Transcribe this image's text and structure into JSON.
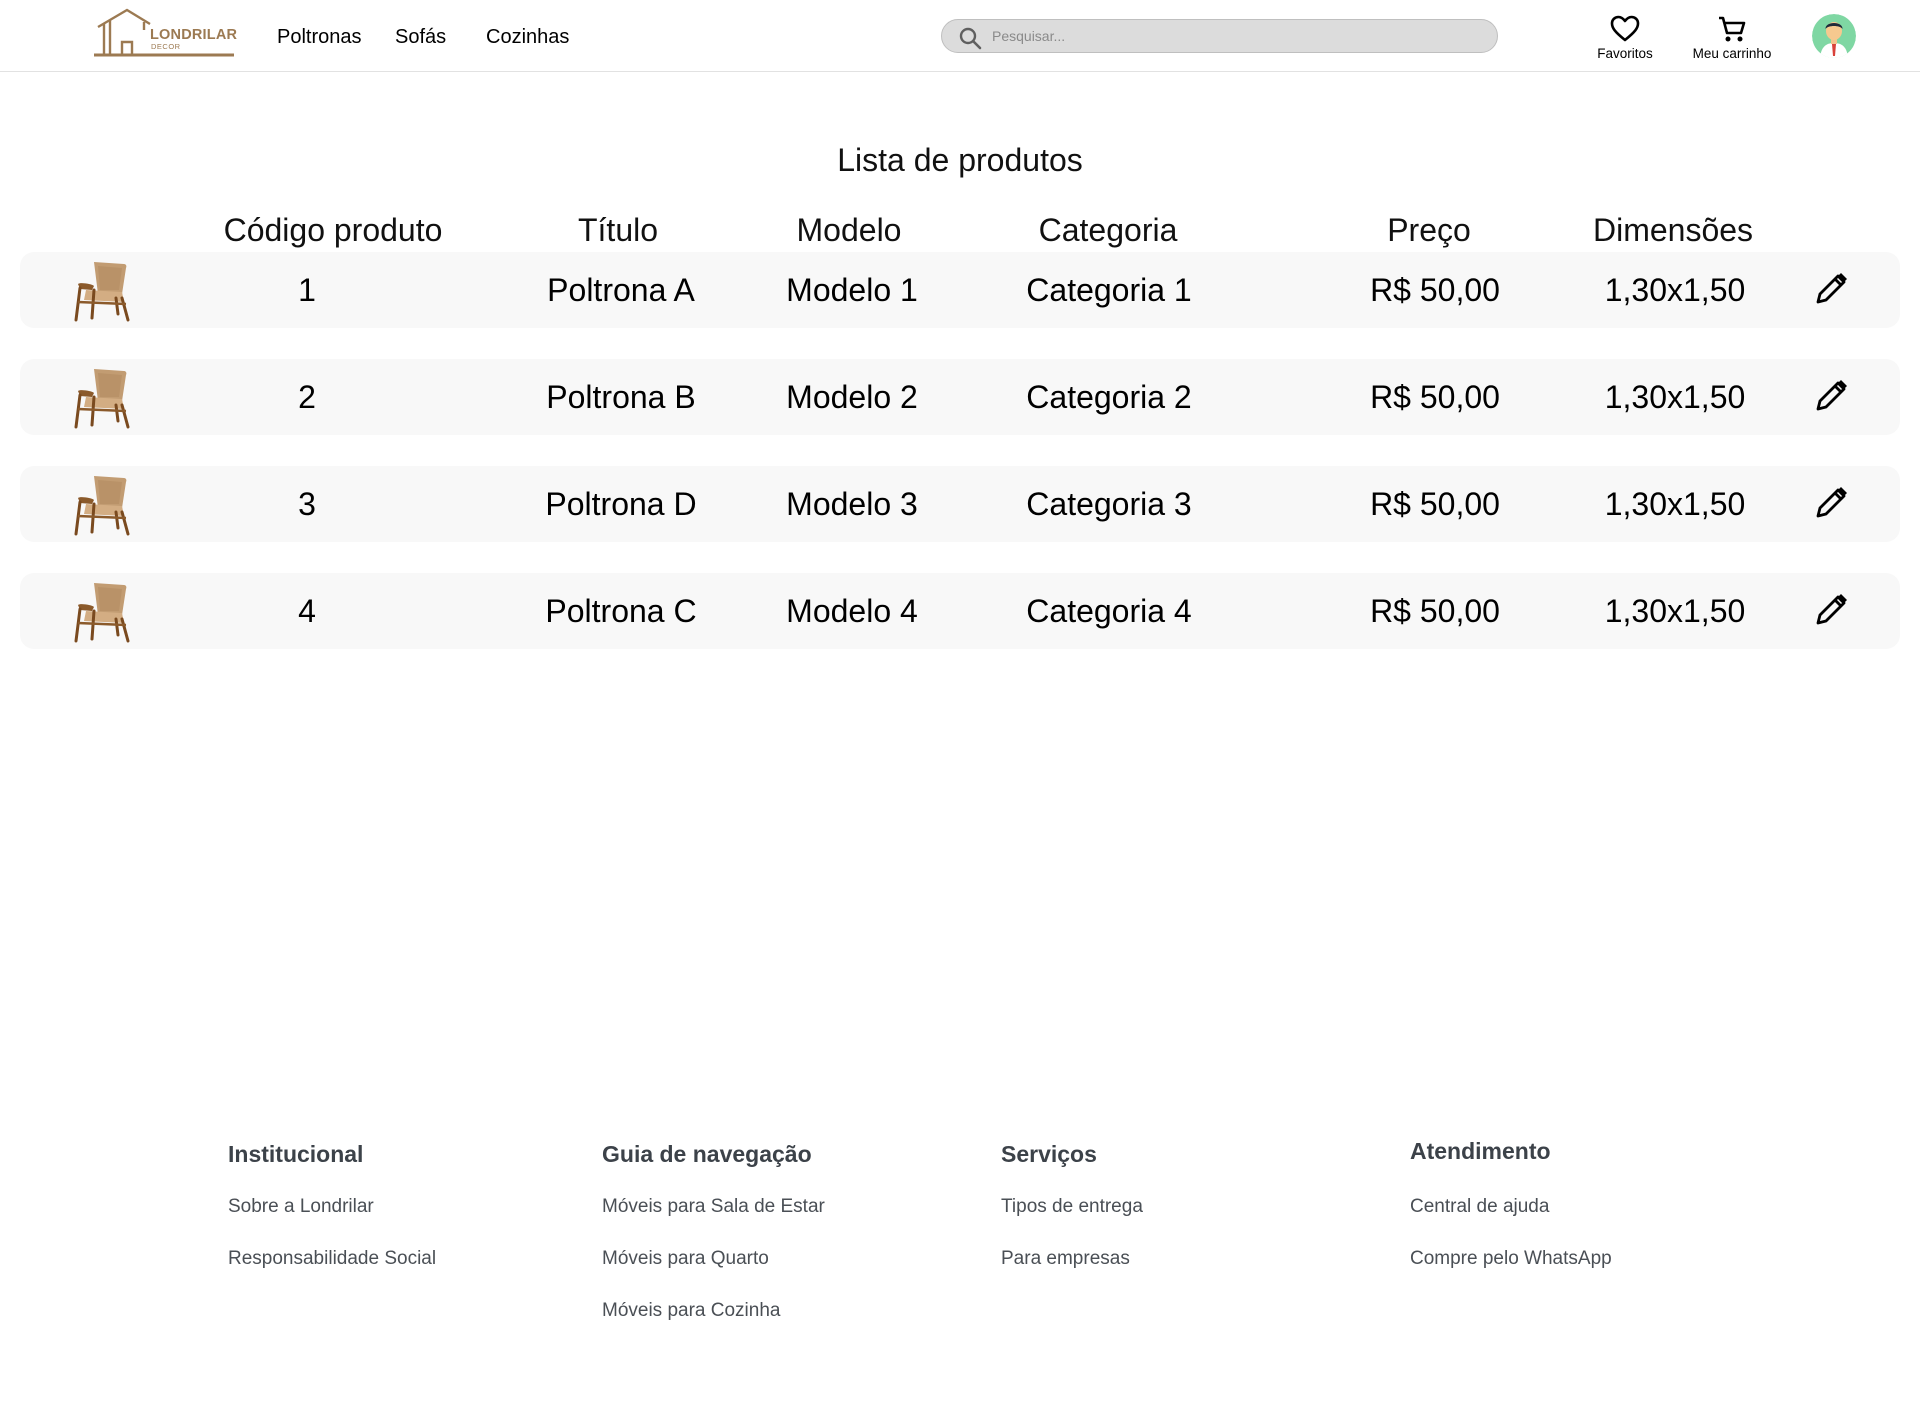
{
  "header": {
    "logo": {
      "name": "LONDRILAR",
      "sub": "DECOR"
    },
    "nav": [
      "Poltronas",
      "Sofás",
      "Cozinhas"
    ],
    "search_placeholder": "Pesquisar...",
    "favorites_label": "Favoritos",
    "cart_label": "Meu carrinho"
  },
  "main": {
    "title": "Lista de produtos",
    "columns": [
      "Código produto",
      "Título",
      "Modelo",
      "Categoria",
      "Preço",
      "Dimensões"
    ],
    "products": [
      {
        "code": "1",
        "title": "Poltrona A",
        "model": "Modelo 1",
        "category": "Categoria 1",
        "price": "R$ 50,00",
        "dimensions": "1,30x1,50"
      },
      {
        "code": "2",
        "title": "Poltrona B",
        "model": "Modelo 2",
        "category": "Categoria 2",
        "price": "R$ 50,00",
        "dimensions": "1,30x1,50"
      },
      {
        "code": "3",
        "title": "Poltrona D",
        "model": "Modelo 3",
        "category": "Categoria 3",
        "price": "R$ 50,00",
        "dimensions": "1,30x1,50"
      },
      {
        "code": "4",
        "title": "Poltrona C",
        "model": "Modelo 4",
        "category": "Categoria 4",
        "price": "R$ 50,00",
        "dimensions": "1,30x1,50"
      }
    ],
    "icons": {
      "product_image": "armchair-icon",
      "edit": "pencil-icon"
    }
  },
  "footer": {
    "columns": [
      {
        "title": "Institucional",
        "links": [
          "Sobre a Londrilar",
          "Responsabilidade Social"
        ]
      },
      {
        "title": "Guia de navegação",
        "links": [
          "Móveis para Sala de Estar",
          "Móveis para Quarto",
          "Móveis para Cozinha"
        ]
      },
      {
        "title": "Serviços",
        "links": [
          "Tipos de entrega",
          "Para empresas"
        ]
      },
      {
        "title": "Atendimento",
        "links": [
          "Central de ajuda",
          "Compre pelo WhatsApp"
        ]
      }
    ]
  },
  "colors": {
    "brand": "#9c7a52",
    "row_bg": "#f8f8f8",
    "footer_text": "#4a4f55",
    "search_bg": "#dcdcdc"
  }
}
